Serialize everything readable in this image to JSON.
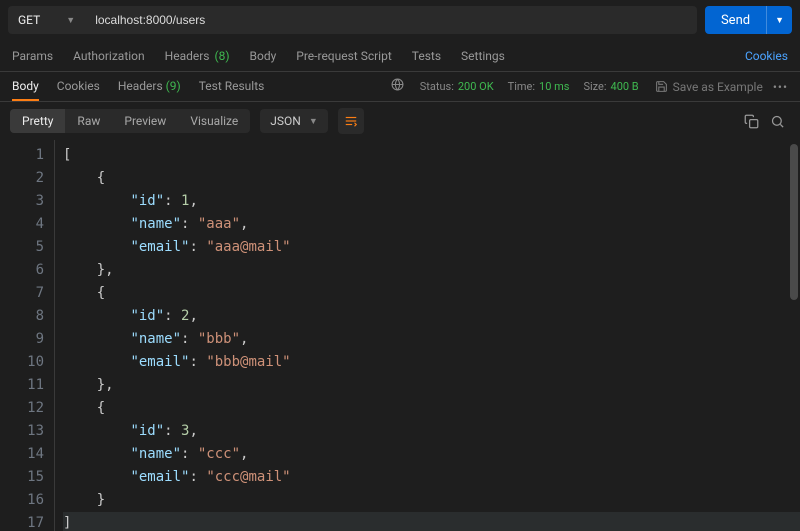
{
  "request": {
    "method": "GET",
    "url": "localhost:8000/users",
    "send_label": "Send"
  },
  "request_tabs": {
    "params": "Params",
    "authorization": "Authorization",
    "headers": "Headers",
    "headers_count": "(8)",
    "body": "Body",
    "prerequest": "Pre-request Script",
    "tests": "Tests",
    "settings": "Settings",
    "cookies_link": "Cookies"
  },
  "response_tabs": {
    "body": "Body",
    "cookies": "Cookies",
    "headers": "Headers",
    "headers_count": "(9)",
    "test_results": "Test Results"
  },
  "status": {
    "label": "Status:",
    "value": "200 OK",
    "time_label": "Time:",
    "time_value": "10 ms",
    "size_label": "Size:",
    "size_value": "400 B",
    "save_example": "Save as Example"
  },
  "viewer": {
    "pretty": "Pretty",
    "raw": "Raw",
    "preview": "Preview",
    "visualize": "Visualize",
    "format": "JSON"
  },
  "code_lines": [
    {
      "n": 1,
      "indent": 0,
      "tokens": [
        {
          "t": "p",
          "v": "["
        }
      ]
    },
    {
      "n": 2,
      "indent": 1,
      "tokens": [
        {
          "t": "p",
          "v": "{"
        }
      ]
    },
    {
      "n": 3,
      "indent": 2,
      "tokens": [
        {
          "t": "k",
          "v": "\"id\""
        },
        {
          "t": "p",
          "v": ": "
        },
        {
          "t": "n",
          "v": "1"
        },
        {
          "t": "p",
          "v": ","
        }
      ]
    },
    {
      "n": 4,
      "indent": 2,
      "tokens": [
        {
          "t": "k",
          "v": "\"name\""
        },
        {
          "t": "p",
          "v": ": "
        },
        {
          "t": "s",
          "v": "\"aaa\""
        },
        {
          "t": "p",
          "v": ","
        }
      ]
    },
    {
      "n": 5,
      "indent": 2,
      "tokens": [
        {
          "t": "k",
          "v": "\"email\""
        },
        {
          "t": "p",
          "v": ": "
        },
        {
          "t": "s",
          "v": "\"aaa@mail\""
        }
      ]
    },
    {
      "n": 6,
      "indent": 1,
      "tokens": [
        {
          "t": "p",
          "v": "},"
        }
      ]
    },
    {
      "n": 7,
      "indent": 1,
      "tokens": [
        {
          "t": "p",
          "v": "{"
        }
      ]
    },
    {
      "n": 8,
      "indent": 2,
      "tokens": [
        {
          "t": "k",
          "v": "\"id\""
        },
        {
          "t": "p",
          "v": ": "
        },
        {
          "t": "n",
          "v": "2"
        },
        {
          "t": "p",
          "v": ","
        }
      ]
    },
    {
      "n": 9,
      "indent": 2,
      "tokens": [
        {
          "t": "k",
          "v": "\"name\""
        },
        {
          "t": "p",
          "v": ": "
        },
        {
          "t": "s",
          "v": "\"bbb\""
        },
        {
          "t": "p",
          "v": ","
        }
      ]
    },
    {
      "n": 10,
      "indent": 2,
      "tokens": [
        {
          "t": "k",
          "v": "\"email\""
        },
        {
          "t": "p",
          "v": ": "
        },
        {
          "t": "s",
          "v": "\"bbb@mail\""
        }
      ]
    },
    {
      "n": 11,
      "indent": 1,
      "tokens": [
        {
          "t": "p",
          "v": "},"
        }
      ]
    },
    {
      "n": 12,
      "indent": 1,
      "tokens": [
        {
          "t": "p",
          "v": "{"
        }
      ]
    },
    {
      "n": 13,
      "indent": 2,
      "tokens": [
        {
          "t": "k",
          "v": "\"id\""
        },
        {
          "t": "p",
          "v": ": "
        },
        {
          "t": "n",
          "v": "3"
        },
        {
          "t": "p",
          "v": ","
        }
      ]
    },
    {
      "n": 14,
      "indent": 2,
      "tokens": [
        {
          "t": "k",
          "v": "\"name\""
        },
        {
          "t": "p",
          "v": ": "
        },
        {
          "t": "s",
          "v": "\"ccc\""
        },
        {
          "t": "p",
          "v": ","
        }
      ]
    },
    {
      "n": 15,
      "indent": 2,
      "tokens": [
        {
          "t": "k",
          "v": "\"email\""
        },
        {
          "t": "p",
          "v": ": "
        },
        {
          "t": "s",
          "v": "\"ccc@mail\""
        }
      ]
    },
    {
      "n": 16,
      "indent": 1,
      "tokens": [
        {
          "t": "p",
          "v": "}"
        }
      ]
    },
    {
      "n": 17,
      "indent": 0,
      "tokens": [
        {
          "t": "p",
          "v": "]"
        }
      ],
      "last": true
    }
  ]
}
